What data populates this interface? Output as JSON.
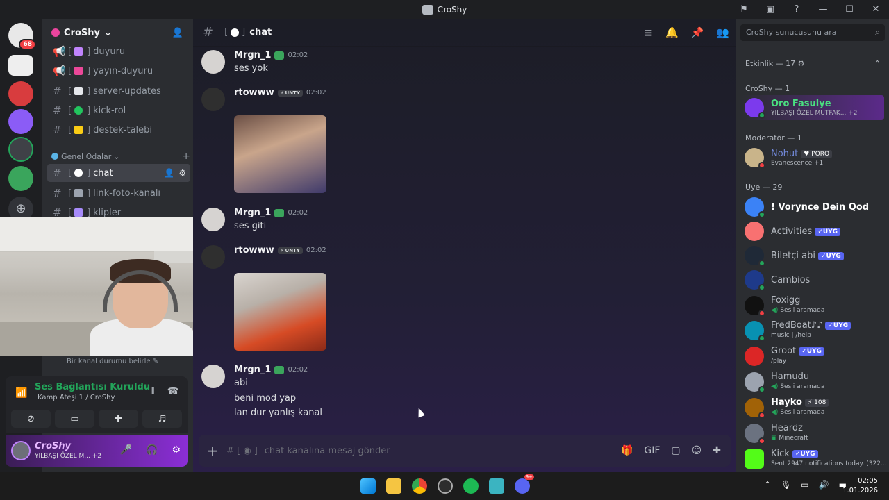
{
  "window": {
    "title": "CroShy"
  },
  "servers": {
    "badge_main": "68"
  },
  "sidebar": {
    "server_name": "CroShy",
    "channels_top": [
      {
        "label": "duyuru",
        "icon": "megaphone-icon"
      },
      {
        "label": "yayın-duyuru",
        "icon": "megaphone-icon"
      },
      {
        "label": "server-updates",
        "icon": "hash-icon"
      },
      {
        "label": "kick-rol",
        "icon": "hash-icon"
      },
      {
        "label": "destek-talebi",
        "icon": "hash-icon"
      }
    ],
    "category": "Genel Odalar",
    "channels_general": [
      {
        "label": "chat"
      },
      {
        "label": "link-foto-kanalı"
      },
      {
        "label": "klipler"
      }
    ],
    "status_prompt": "Bir kanal durumu belirle"
  },
  "voice": {
    "title": "Ses Bağlantısı Kuruldu",
    "subtitle": "Kamp Ateşi 1 / CroShy"
  },
  "user": {
    "name": "CroShy",
    "status": "YILBAŞI ÖZEL M...",
    "extra": "+2"
  },
  "chat": {
    "channel": "chat",
    "messages": [
      {
        "author": "Mrgn_1",
        "time": "02:02",
        "lines": [
          "ses yok"
        ]
      },
      {
        "author": "rtowww",
        "tag": "UNTY",
        "time": "02:02",
        "lines": []
      },
      {
        "author": "Mrgn_1",
        "time": "02:02",
        "lines": [
          "ses giti"
        ]
      },
      {
        "author": "rtowww",
        "tag": "UNTY",
        "time": "02:02",
        "lines": []
      },
      {
        "author": "Mrgn_1",
        "time": "02:02",
        "lines": [
          "abi",
          "beni mod yap",
          "lan dur yanlış kanal"
        ]
      }
    ],
    "composer_placeholder": "chat kanalına mesaj gönder"
  },
  "members": {
    "search_placeholder": "CroShy sunucusunu ara",
    "activity_header": "Etkinlik — 17",
    "groups": [
      {
        "header": "CroShy — 1"
      },
      {
        "header": "Moderatör — 1"
      },
      {
        "header": "Üye — 29"
      }
    ],
    "list": [
      {
        "name": "Oro Fasulye",
        "sub": "YILBAŞI ÖZEL MUTFAK...",
        "extra": "+2"
      },
      {
        "name": "Nohut",
        "badge": "PORO",
        "sub": "Evanescence +1"
      },
      {
        "name": "! Vorynce Dein Qod",
        "sub": ""
      },
      {
        "name": "Activities",
        "badge": "UYG",
        "sub": ""
      },
      {
        "name": "Biletçi abi",
        "badge": "UYG",
        "sub": ""
      },
      {
        "name": "Cambios",
        "sub": ""
      },
      {
        "name": "Foxigg",
        "sub": "Sesli aramada"
      },
      {
        "name": "FredBoat♪♪",
        "badge": "UYG",
        "sub": "music | /help"
      },
      {
        "name": "Groot",
        "badge": "UYG",
        "sub": "/play"
      },
      {
        "name": "Hamudu",
        "sub": "Sesli aramada"
      },
      {
        "name": "Hayko",
        "badge": "108",
        "sub": "Sesli aramada"
      },
      {
        "name": "Heardz",
        "sub": "Minecraft"
      },
      {
        "name": "Kick",
        "badge": "UYG",
        "sub": "Sent 2947 notifications today. (322..."
      }
    ]
  },
  "taskbar": {
    "time": "02:05",
    "date": "1.01.2026",
    "discord_badge": "9+"
  },
  "colors": {
    "accent": "#5865f2",
    "online": "#23a55a",
    "dnd": "#f23f43"
  }
}
